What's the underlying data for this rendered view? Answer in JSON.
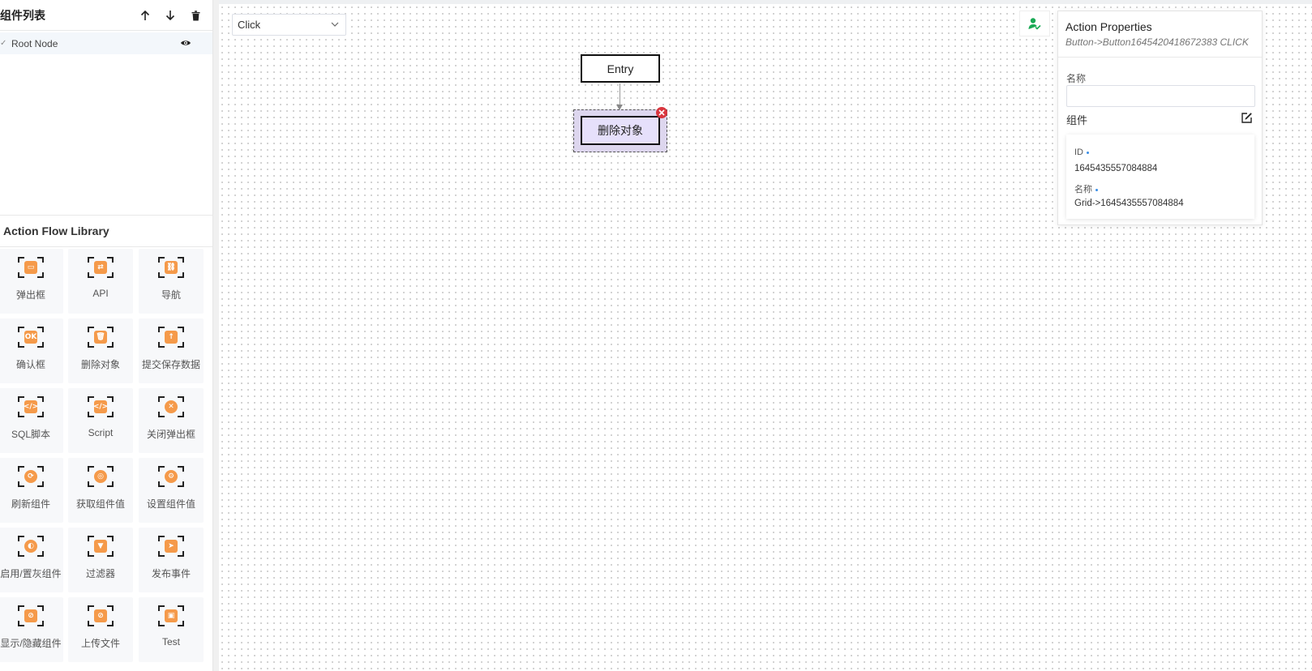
{
  "component_tree": {
    "title": "组件列表",
    "move_up_icon": "arrow-up-icon",
    "move_down_icon": "arrow-down-icon",
    "delete_icon": "trash-icon",
    "root": {
      "label": "Root Node",
      "visibility_icon": "eye-icon"
    }
  },
  "library": {
    "title": "Action Flow Library",
    "items": [
      {
        "label": "弹出框",
        "icon": "popup-icon",
        "glyph": "▭"
      },
      {
        "label": "API",
        "icon": "api-icon",
        "glyph": "⇄"
      },
      {
        "label": "导航",
        "icon": "navigate-icon",
        "glyph": "⛓"
      },
      {
        "label": "确认框",
        "icon": "confirm-icon",
        "glyph": "OK"
      },
      {
        "label": "删除对象",
        "icon": "delete-object-icon",
        "glyph": "🗑"
      },
      {
        "label": "提交保存数据",
        "icon": "submit-icon",
        "glyph": "↑"
      },
      {
        "label": "SQL脚本",
        "icon": "sql-icon",
        "glyph": "</>"
      },
      {
        "label": "Script",
        "icon": "script-icon",
        "glyph": "</>"
      },
      {
        "label": "关闭弹出框",
        "icon": "close-popup-icon",
        "glyph": "✕"
      },
      {
        "label": "刷新组件",
        "icon": "refresh-icon",
        "glyph": "⟳"
      },
      {
        "label": "获取组件值",
        "icon": "get-value-icon",
        "glyph": "◎"
      },
      {
        "label": "设置组件值",
        "icon": "set-value-icon",
        "glyph": "⚙"
      },
      {
        "label": "启用/置灰组件",
        "icon": "toggle-icon",
        "glyph": "◐"
      },
      {
        "label": "过滤器",
        "icon": "filter-icon",
        "glyph": "▼"
      },
      {
        "label": "发布事件",
        "icon": "publish-icon",
        "glyph": "➤"
      },
      {
        "label": "显示/隐藏组件",
        "icon": "visibility-icon",
        "glyph": "⊘"
      },
      {
        "label": "上传文件",
        "icon": "upload-icon",
        "glyph": "⊘"
      },
      {
        "label": "Test",
        "icon": "test-icon",
        "glyph": "▣"
      }
    ]
  },
  "canvas": {
    "event_select": {
      "value": "Click",
      "icon": "chevron-down-icon"
    },
    "nodes": {
      "entry": "Entry",
      "action": "删除对象"
    },
    "user_button_icon": "user-check-icon",
    "remove_node_icon": "close-circle-icon"
  },
  "properties": {
    "title": "Action Properties",
    "subtitle": "Button->Button1645420418672383 CLICK",
    "name_label": "名称",
    "name_value": "",
    "component_label": "组件",
    "edit_icon": "edit-icon",
    "component": {
      "id_label": "ID",
      "id_value": "1645435557084884",
      "name_label": "名称",
      "name_value": "Grid->1645435557084884"
    }
  },
  "colors": {
    "accent_orange": "#f59a4a",
    "node_fill": "#e6e0fb",
    "danger": "#d9363e",
    "user_green": "#1aaa55"
  }
}
